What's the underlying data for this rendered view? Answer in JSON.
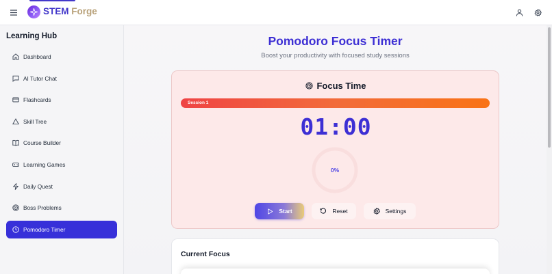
{
  "header": {
    "brand_word1": "STEM",
    "brand_word2": "Forge",
    "icons": {
      "menu": "hamburger-menu-icon",
      "logo": "sparkle-icon",
      "user": "user-icon",
      "settings": "gear-icon"
    }
  },
  "sidebar": {
    "title": "Learning Hub",
    "items": [
      {
        "label": "Dashboard",
        "icon": "home-icon",
        "active": false
      },
      {
        "label": "AI Tutor Chat",
        "icon": "chat-bubble-icon",
        "active": false
      },
      {
        "label": "Flashcards",
        "icon": "credit-card-icon",
        "active": false
      },
      {
        "label": "Skill Tree",
        "icon": "triangle-icon",
        "active": false
      },
      {
        "label": "Course Builder",
        "icon": "open-book-icon",
        "active": false
      },
      {
        "label": "Learning Games",
        "icon": "gamepad-icon",
        "active": false
      },
      {
        "label": "Daily Quest",
        "icon": "lightning-icon",
        "active": false
      },
      {
        "label": "Boss Problems",
        "icon": "target-icon",
        "active": false
      },
      {
        "label": "Pomodoro Timer",
        "icon": "clock-icon",
        "active": true
      }
    ]
  },
  "main": {
    "title": "Pomodoro Focus Timer",
    "subtitle": "Boost your productivity with focused study sessions",
    "timer": {
      "mode_label": "Focus Time",
      "session_label": "Session 1",
      "time": "01:00",
      "progress_text": "0%",
      "progress_fraction": 0
    },
    "buttons": {
      "start": "Start",
      "reset": "Reset",
      "settings": "Settings"
    },
    "current_focus": {
      "title": "Current Focus"
    }
  },
  "colors": {
    "accent": "#3d2fd4",
    "active_nav": "#3730d9",
    "session_bar_start": "#ef4444",
    "session_bar_end": "#f97316",
    "timer_card_bg": "#fde9e9"
  }
}
